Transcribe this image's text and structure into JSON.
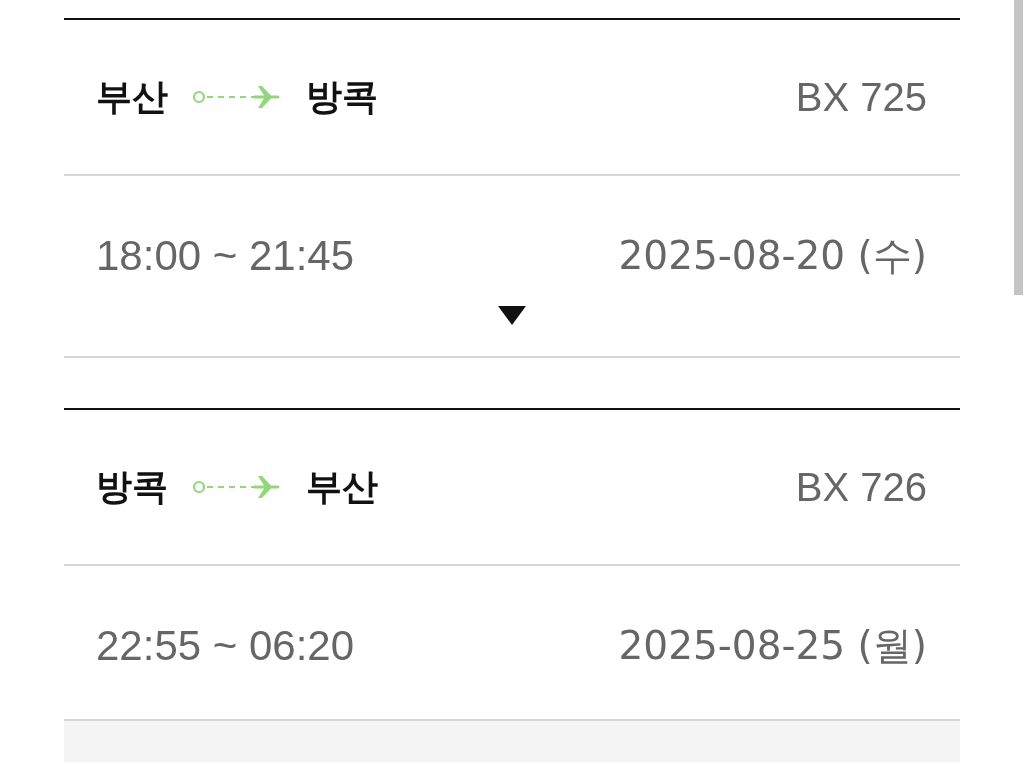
{
  "flights": [
    {
      "origin": "부산",
      "destination": "방콕",
      "flight_number": "BX 725",
      "times": "18:00 ~ 21:45",
      "date": "2025-08-20 (수)",
      "expandable": true
    },
    {
      "origin": "방콕",
      "destination": "부산",
      "flight_number": "BX 726",
      "times": "22:55 ~ 06:20",
      "date": "2025-08-25 (월)",
      "expandable": false
    }
  ]
}
